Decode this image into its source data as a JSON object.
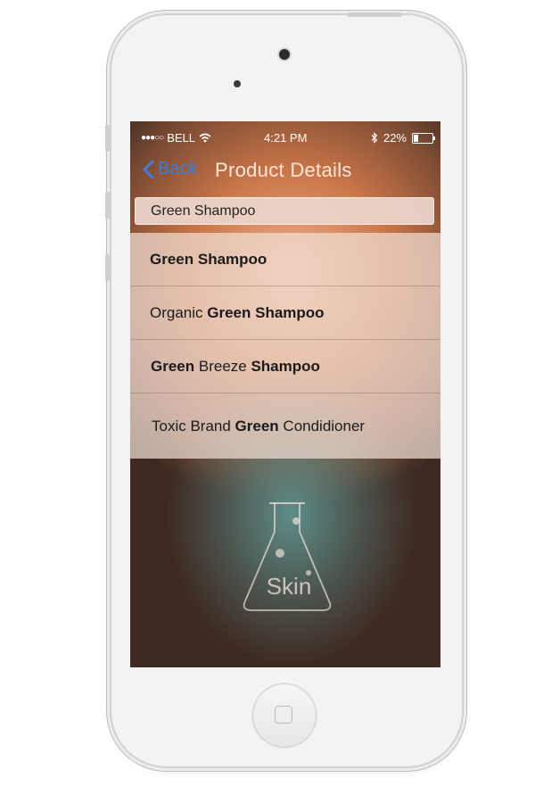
{
  "status_bar": {
    "signal": "●●●○○",
    "carrier": "BELL",
    "time": "4:21 PM",
    "battery_percent": "22%",
    "battery_level": 0.22
  },
  "navbar": {
    "back_label": "Back",
    "title": "Product Details"
  },
  "search": {
    "value": "Green Shampoo"
  },
  "results": [
    {
      "segments": [
        {
          "text": "Green Shampoo",
          "bold": true
        }
      ]
    },
    {
      "segments": [
        {
          "text": "Organic ",
          "bold": false
        },
        {
          "text": "Green Shampoo",
          "bold": true
        }
      ]
    },
    {
      "segments": [
        {
          "text": "Green",
          "bold": true
        },
        {
          "text": " Breeze ",
          "bold": false
        },
        {
          "text": "Shampoo",
          "bold": true
        }
      ]
    },
    {
      "segments": [
        {
          "text": "Toxic Brand ",
          "bold": false
        },
        {
          "text": "Green",
          "bold": true
        },
        {
          "text": " Condidioner",
          "bold": false
        }
      ]
    }
  ],
  "logo": {
    "text": "Skin",
    "icon": "flask-icon"
  },
  "colors": {
    "back_blue": "#3b7fd6",
    "title_text": "#fbe6da"
  }
}
